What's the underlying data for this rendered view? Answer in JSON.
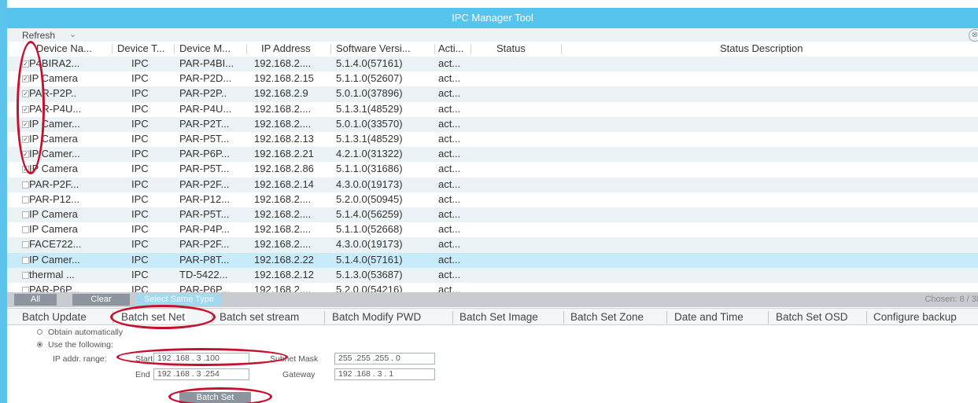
{
  "window": {
    "title": "IPC Manager Tool"
  },
  "toolbar": {
    "refresh_label": "Refresh",
    "chevron": "⌄",
    "close_glyph": "⊗"
  },
  "columns": [
    "Device Na...",
    "Device T...",
    "Device M...",
    "IP Address",
    "Software Versi...",
    "Acti...",
    "Status",
    "Status Description"
  ],
  "rows": [
    {
      "checked": true,
      "name": "P4BIRA2...",
      "type": "IPC",
      "model": "PAR-P4BI...",
      "ip": "192.168.2....",
      "version": "5.1.4.0(57161)",
      "active": "act..."
    },
    {
      "checked": true,
      "name": "IP Camera",
      "type": "IPC",
      "model": "PAR-P2D...",
      "ip": "192.168.2.15",
      "version": "5.1.1.0(52607)",
      "active": "act..."
    },
    {
      "checked": true,
      "name": "PAR-P2P..",
      "type": "IPC",
      "model": "PAR-P2P..",
      "ip": "192.168.2.9",
      "version": "5.0.1.0(37896)",
      "active": "act..."
    },
    {
      "checked": true,
      "name": "PAR-P4U...",
      "type": "IPC",
      "model": "PAR-P4U...",
      "ip": "192.168.2....",
      "version": "5.1.3.1(48529)",
      "active": "act..."
    },
    {
      "checked": true,
      "name": "IP Camer...",
      "type": "IPC",
      "model": "PAR-P2T...",
      "ip": "192.168.2....",
      "version": "5.0.1.0(33570)",
      "active": "act..."
    },
    {
      "checked": true,
      "name": "IP Camera",
      "type": "IPC",
      "model": "PAR-P5T...",
      "ip": "192.168.2.13",
      "version": "5.1.3.1(48529)",
      "active": "act..."
    },
    {
      "checked": true,
      "name": "IP Camer...",
      "type": "IPC",
      "model": "PAR-P6P...",
      "ip": "192.168.2.21",
      "version": "4.2.1.0(31322)",
      "active": "act..."
    },
    {
      "checked": true,
      "name": "IP Camera",
      "type": "IPC",
      "model": "PAR-P5T...",
      "ip": "192.168.2.86",
      "version": "5.1.1.0(31686)",
      "active": "act..."
    },
    {
      "checked": false,
      "name": "PAR-P2F...",
      "type": "IPC",
      "model": "PAR-P2F...",
      "ip": "192.168.2.14",
      "version": "4.3.0.0(19173)",
      "active": "act..."
    },
    {
      "checked": false,
      "name": "PAR-P12...",
      "type": "IPC",
      "model": "PAR-P12...",
      "ip": "192.168.2....",
      "version": "5.2.0.0(50945)",
      "active": "act..."
    },
    {
      "checked": false,
      "name": "IP Camera",
      "type": "IPC",
      "model": "PAR-P5T...",
      "ip": "192.168.2....",
      "version": "5.1.4.0(56259)",
      "active": "act..."
    },
    {
      "checked": false,
      "name": "IP Camera",
      "type": "IPC",
      "model": "PAR-P4P...",
      "ip": "192.168.2....",
      "version": "5.1.1.0(52668)",
      "active": "act..."
    },
    {
      "checked": false,
      "name": "FACE722...",
      "type": "IPC",
      "model": "PAR-P2F...",
      "ip": "192.168.2....",
      "version": "4.3.0.0(19173)",
      "active": "act..."
    },
    {
      "checked": false,
      "name": "IP Camer...",
      "type": "IPC",
      "model": "PAR-P8T...",
      "ip": "192.168.2.22",
      "version": "5.1.4.0(57161)",
      "active": "act..."
    },
    {
      "checked": false,
      "name": "thermal ...",
      "type": "IPC",
      "model": "TD-5422...",
      "ip": "192.168.2.12",
      "version": "5.1.3.0(53687)",
      "active": "act..."
    },
    {
      "checked": false,
      "name": "PAR-P6P...",
      "type": "IPC",
      "model": "PAR-P6P...",
      "ip": "192.168.2....",
      "version": "5.2.0.0(54216)",
      "active": "act..."
    }
  ],
  "selection": {
    "all_label": "All",
    "clear_label": "Clear",
    "same_type_label": "Select Same Type",
    "chosen_text": "Chosen: 8 / 38"
  },
  "tabs": [
    "Batch Update",
    "Batch set Net",
    "Batch set stream",
    "Batch Modify PWD",
    "Batch Set Image",
    "Batch Set Zone",
    "Date and Time",
    "Batch Set OSD",
    "Configure backup"
  ],
  "active_tab": "Batch set Net",
  "net_form": {
    "obtain_label": "Obtain automatically",
    "use_following_label": "Use the following:",
    "ip_range_label": "IP addr. range:",
    "start_label": "Start",
    "start_value": "192 .168 .  3  .100",
    "end_label": "End",
    "end_value": "192 .168 .  3  .254",
    "subnet_label": "Subnet Mask",
    "subnet_value": "255 .255 .255 .  0",
    "gateway_label": "Gateway",
    "gateway_value": "192 .168 .  3  .  1",
    "batch_set_label": "Batch Set",
    "use_following_selected": true
  },
  "colors": {
    "title_bar": "#57c4ee",
    "row_alt": "#eaf2f5",
    "row_selected": "#c8ebfa",
    "annotation": "#c8102e"
  }
}
